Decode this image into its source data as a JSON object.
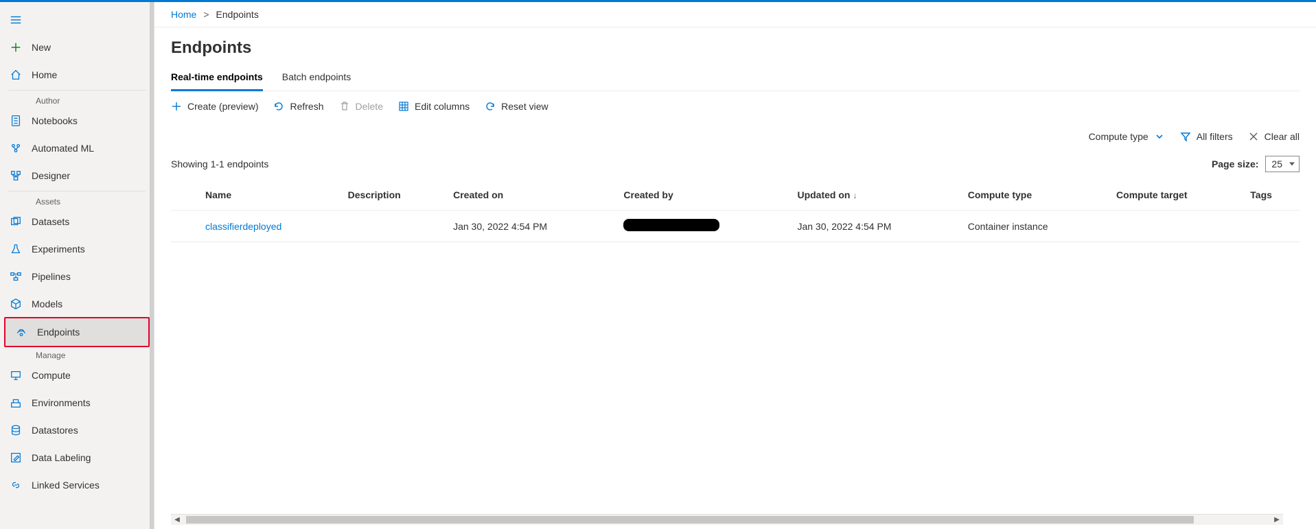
{
  "sidebar": {
    "new_label": "New",
    "home_label": "Home",
    "group_author": "Author",
    "notebooks": "Notebooks",
    "automated_ml": "Automated ML",
    "designer": "Designer",
    "group_assets": "Assets",
    "datasets": "Datasets",
    "experiments": "Experiments",
    "pipelines": "Pipelines",
    "models": "Models",
    "endpoints": "Endpoints",
    "group_manage": "Manage",
    "compute": "Compute",
    "environments": "Environments",
    "datastores": "Datastores",
    "data_labeling": "Data Labeling",
    "linked_services": "Linked Services"
  },
  "breadcrumb": {
    "home": "Home",
    "sep": ">",
    "current": "Endpoints"
  },
  "header": {
    "title": "Endpoints"
  },
  "tabs": {
    "realtime": "Real-time endpoints",
    "batch": "Batch endpoints"
  },
  "toolbar": {
    "create": "Create (preview)",
    "refresh": "Refresh",
    "delete": "Delete",
    "edit_columns": "Edit columns",
    "reset_view": "Reset view"
  },
  "filters": {
    "compute_type": "Compute type",
    "all_filters": "All filters",
    "clear_all": "Clear all"
  },
  "list": {
    "showing": "Showing 1-1 endpoints",
    "page_size_label": "Page size:",
    "page_size_value": "25"
  },
  "columns": {
    "name": "Name",
    "description": "Description",
    "created_on": "Created on",
    "created_by": "Created by",
    "updated_on": "Updated on",
    "compute_type": "Compute type",
    "compute_target": "Compute target",
    "tags": "Tags"
  },
  "rows": [
    {
      "name": "classifierdeployed",
      "description": "",
      "created_on": "Jan 30, 2022 4:54 PM",
      "created_by": "",
      "updated_on": "Jan 30, 2022 4:54 PM",
      "compute_type": "Container instance",
      "compute_target": "",
      "tags": ""
    }
  ]
}
